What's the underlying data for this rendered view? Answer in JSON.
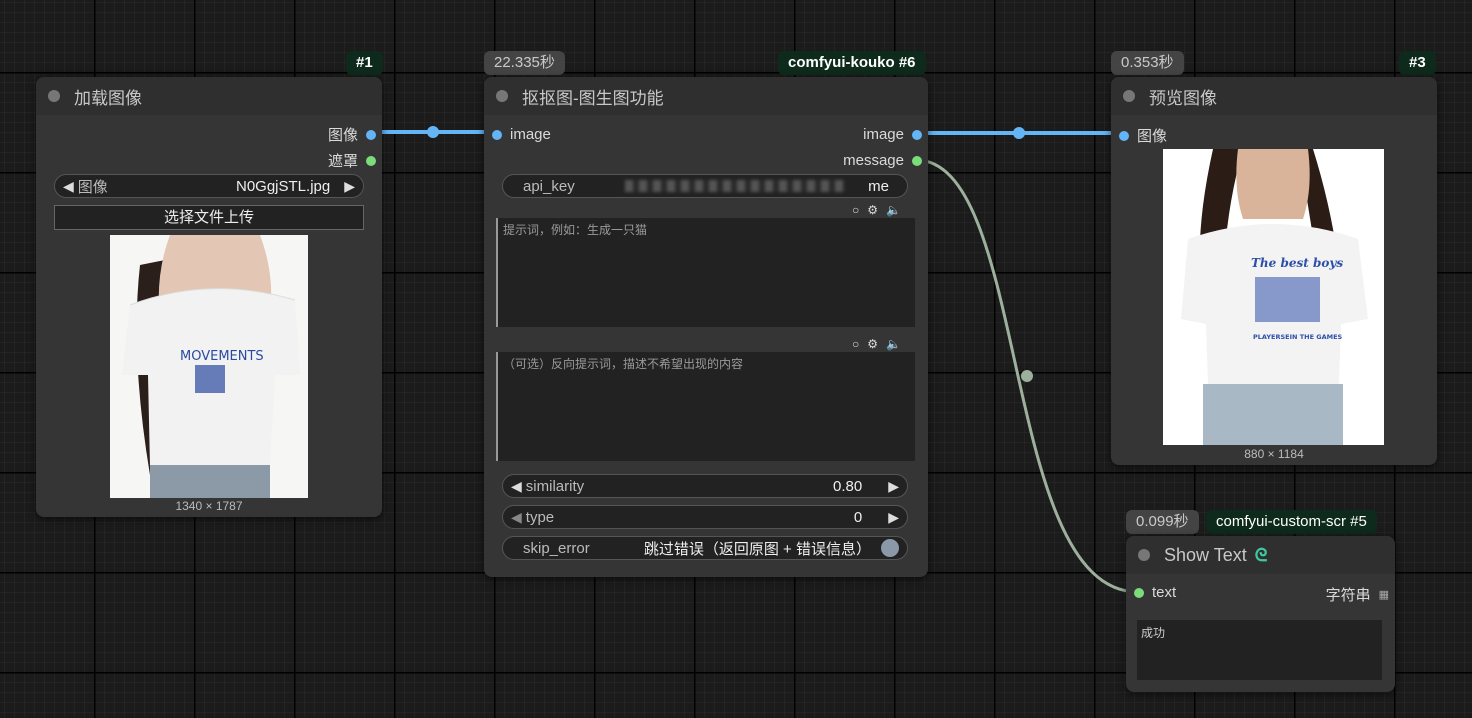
{
  "nodes": {
    "load_image": {
      "id_badge": "#1",
      "title": "加载图像",
      "outputs": [
        "图像",
        "遮罩"
      ],
      "image_widget": {
        "label": "图像",
        "value": "N0GgjSTL.jpg"
      },
      "upload_button": "选择文件上传",
      "image_size": "1340 × 1787",
      "shirt_text": [
        "MOVEMENTS"
      ]
    },
    "koukou": {
      "time_badge": "22.335秒",
      "id_badge": "comfyui-kouko #6",
      "title": "抠抠图-图生图功能",
      "input": "image",
      "outputs": [
        "image",
        "message"
      ],
      "api_key": {
        "label": "api_key",
        "value": "me"
      },
      "prompt_placeholder": "提示词，例如：生成一只猫",
      "negative_placeholder": "（可选）反向提示词，描述不希望出现的内容",
      "similarity": {
        "label": "similarity",
        "value": "0.80"
      },
      "type": {
        "label": "type",
        "value": "0"
      },
      "skip_error": {
        "label": "skip_error",
        "value": "跳过错误（返回原图 + 错误信息）"
      }
    },
    "preview": {
      "time_badge": "0.353秒",
      "id_badge": "#3",
      "title": "预览图像",
      "input": "图像",
      "image_size": "880 × 1184",
      "shirt_text": [
        "The best boys",
        "PLAYERSEIN THE GAMES"
      ]
    },
    "show_text": {
      "time_badge": "0.099秒",
      "id_badge": "comfyui-custom-scr #5",
      "title": "Show Text",
      "input": "text",
      "output": "字符串",
      "content": "成功"
    }
  },
  "colors": {
    "image_link": "#64b5f6",
    "string_link": "#9db09d",
    "node_bg": "#353535",
    "badge_id_bg": "#0e2a1c"
  },
  "icons": [
    "circle-icon",
    "gear-icon",
    "speaker-icon",
    "grid-icon",
    "link-logo-icon"
  ]
}
